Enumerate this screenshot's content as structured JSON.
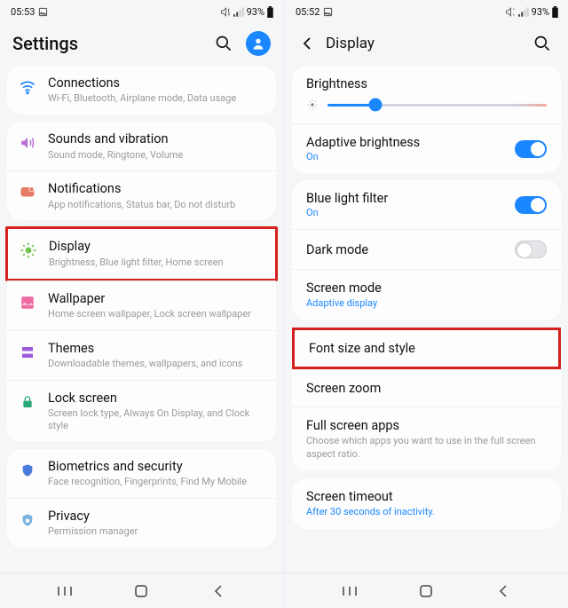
{
  "left": {
    "statusbar": {
      "time": "05:53",
      "battery": "93%"
    },
    "header": {
      "title": "Settings"
    },
    "groups": [
      {
        "items": [
          {
            "title": "Connections",
            "sub": "Wi-Fi, Bluetooth, Airplane mode, Data usage"
          }
        ]
      },
      {
        "items": [
          {
            "title": "Sounds and vibration",
            "sub": "Sound mode, Ringtone, Volume"
          },
          {
            "title": "Notifications",
            "sub": "App notifications, Status bar, Do not disturb"
          }
        ]
      },
      {
        "items": [
          {
            "title": "Display",
            "sub": "Brightness, Blue light filter, Home screen"
          },
          {
            "title": "Wallpaper",
            "sub": "Home screen wallpaper, Lock screen wallpaper"
          },
          {
            "title": "Themes",
            "sub": "Downloadable themes, wallpapers, and icons"
          },
          {
            "title": "Lock screen",
            "sub": "Screen lock type, Always On Display, and Clock style"
          }
        ]
      },
      {
        "items": [
          {
            "title": "Biometrics and security",
            "sub": "Face recognition, Fingerprints, Find My Mobile"
          },
          {
            "title": "Privacy",
            "sub": "Permission manager"
          }
        ]
      }
    ]
  },
  "right": {
    "statusbar": {
      "time": "05:52",
      "battery": "93%"
    },
    "header": {
      "title": "Display"
    },
    "brightness_label": "Brightness",
    "adaptive": {
      "title": "Adaptive brightness",
      "state": "On"
    },
    "blue": {
      "title": "Blue light filter",
      "state": "On"
    },
    "dark": {
      "title": "Dark mode"
    },
    "screenmode": {
      "title": "Screen mode",
      "state": "Adaptive display"
    },
    "font": {
      "title": "Font size and style"
    },
    "zoom": {
      "title": "Screen zoom"
    },
    "fullscreen": {
      "title": "Full screen apps",
      "sub": "Choose which apps you want to use in the full screen aspect ratio."
    },
    "timeout": {
      "title": "Screen timeout",
      "sub": "After 30 seconds of inactivity."
    }
  }
}
